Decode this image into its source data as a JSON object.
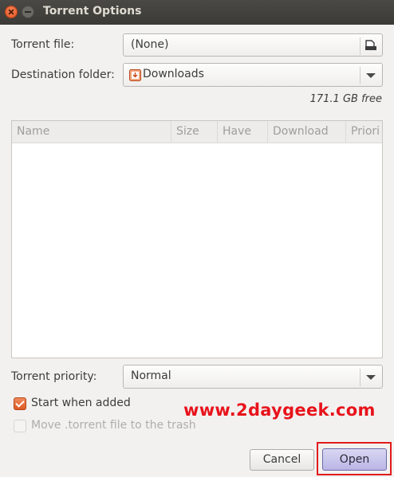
{
  "window": {
    "title": "Torrent Options"
  },
  "form": {
    "torrent_file_label": "Torrent file:",
    "torrent_file_value": "(None)",
    "destination_label": "Destination folder:",
    "destination_value": "Downloads",
    "free_space": "171.1 GB free",
    "priority_label": "Torrent priority:",
    "priority_value": "Normal"
  },
  "table": {
    "columns": [
      "Name",
      "Size",
      "Have",
      "Download",
      "Priori"
    ]
  },
  "options": {
    "start_when_added": {
      "label": "Start when added",
      "checked": true
    },
    "move_to_trash": {
      "label": "Move .torrent file to the trash",
      "checked": false,
      "enabled": false
    }
  },
  "watermark": "www.2daygeek.com",
  "buttons": {
    "cancel": "Cancel",
    "open": "Open"
  },
  "colors": {
    "accent": "#dd5a23",
    "highlight_frame": "#e01b1b",
    "watermark": "#e8131b"
  }
}
